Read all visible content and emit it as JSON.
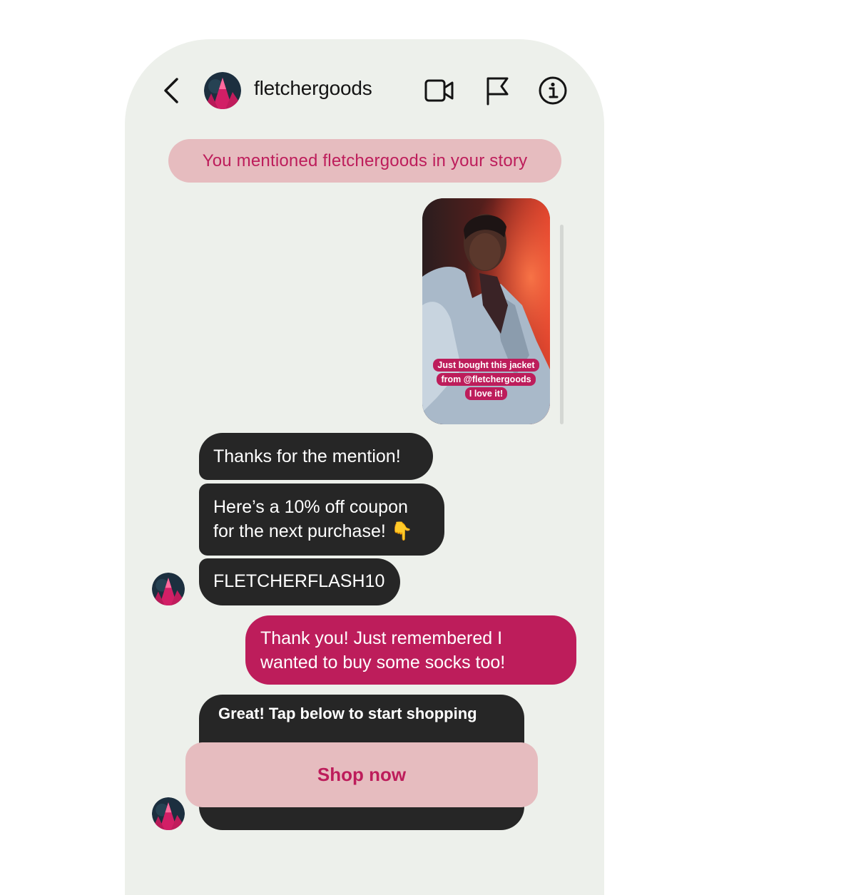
{
  "header": {
    "username": "fletchergoods",
    "icons": [
      "back-arrow-icon",
      "video-call-icon",
      "flag-icon",
      "info-icon"
    ]
  },
  "mention_notice": "You mentioned fletchergoods in your story",
  "story": {
    "caption_lines": [
      "Just bought this jacket",
      "from @fletchergoods",
      "I love it!"
    ]
  },
  "messages": {
    "m1": "Thanks for the mention!",
    "m2_line1": "Here’s a 10% off coupon",
    "m2_line2": "for the next purchase! 👇",
    "m3": "FLETCHERFLASH10",
    "m4_line1": "Thank you! Just remembered I",
    "m4_line2": "wanted to buy some socks too!",
    "card_title": "Great! Tap below to start shopping",
    "card_button": "Shop now"
  },
  "colors": {
    "brand_pink": "#bd1d5b",
    "light_pink": "#e6bcbf",
    "dark_bubble": "#262626",
    "background": "#edf0eb"
  }
}
